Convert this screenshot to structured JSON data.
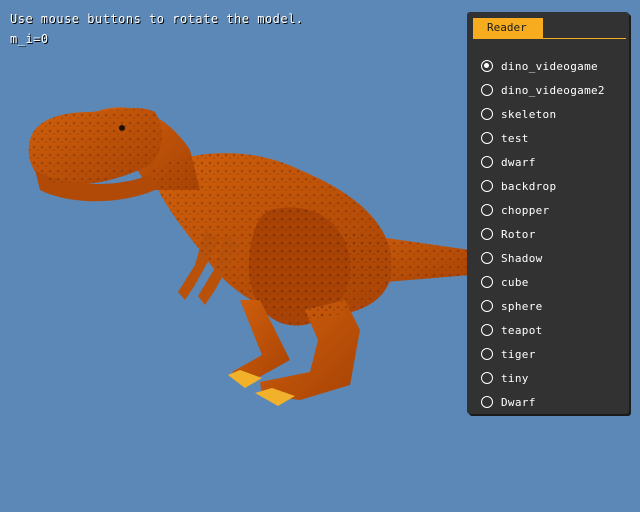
{
  "hud": {
    "instruction": "Use mouse buttons to rotate the model.",
    "status": "m_i=0"
  },
  "panel": {
    "tab_label": "Reader",
    "selected_index": 0,
    "items": [
      {
        "label": "dino_videogame"
      },
      {
        "label": "dino_videogame2"
      },
      {
        "label": "skeleton"
      },
      {
        "label": "test"
      },
      {
        "label": "dwarf"
      },
      {
        "label": "backdrop"
      },
      {
        "label": "chopper"
      },
      {
        "label": "Rotor"
      },
      {
        "label": "Shadow"
      },
      {
        "label": "cube"
      },
      {
        "label": "sphere"
      },
      {
        "label": "teapot"
      },
      {
        "label": "tiger"
      },
      {
        "label": "tiny"
      },
      {
        "label": "Dwarf"
      }
    ]
  },
  "colors": {
    "background": "#5b88b7",
    "panel": "#323232",
    "accent": "#f7ac1f",
    "model_body": "#c24e06"
  }
}
